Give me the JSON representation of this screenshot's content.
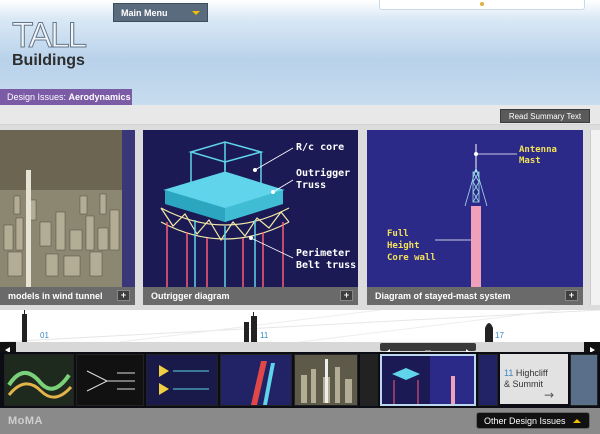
{
  "header": {
    "logo_top": "TALL",
    "logo_bottom": "Buildings",
    "main_menu_label": "Main Menu",
    "breadcrumb_prefix": "Design Issues:",
    "breadcrumb_topic": "Aerodynamics"
  },
  "summary": {
    "read_summary_label": "Read Summary Text"
  },
  "panels": [
    {
      "caption": "models in wind tunnel",
      "icon": "plus-icon"
    },
    {
      "caption": "Outrigger diagram",
      "icon": "plus-icon",
      "labels": {
        "core": "R/c core",
        "outrigger_1": "Outrigger",
        "outrigger_2": "Truss",
        "perimeter_1": "Perimeter",
        "perimeter_2": "Belt truss"
      }
    },
    {
      "caption": "Diagram of stayed-mast system",
      "icon": "plus-icon",
      "labels": {
        "antenna_1": "Antenna",
        "antenna_2": "Mast",
        "core_1": "Full",
        "core_2": "Height",
        "core_3": "Core wall"
      }
    }
  ],
  "timeline": {
    "ticks": [
      "01",
      "11",
      "17"
    ]
  },
  "filmstrip": {
    "next_number": "11",
    "next_line1": "Highcliff",
    "next_line2": "& Summit",
    "next_arrow": "→"
  },
  "footer": {
    "brand": "MoMA",
    "other_issues_label": "Other Design Issues"
  },
  "colors": {
    "accent_purple": "#7b5aa6",
    "diagram_cyan": "#5fd4ea",
    "diagram_navy": "#1b1a55",
    "timeline_blue": "#3a8ac4"
  }
}
